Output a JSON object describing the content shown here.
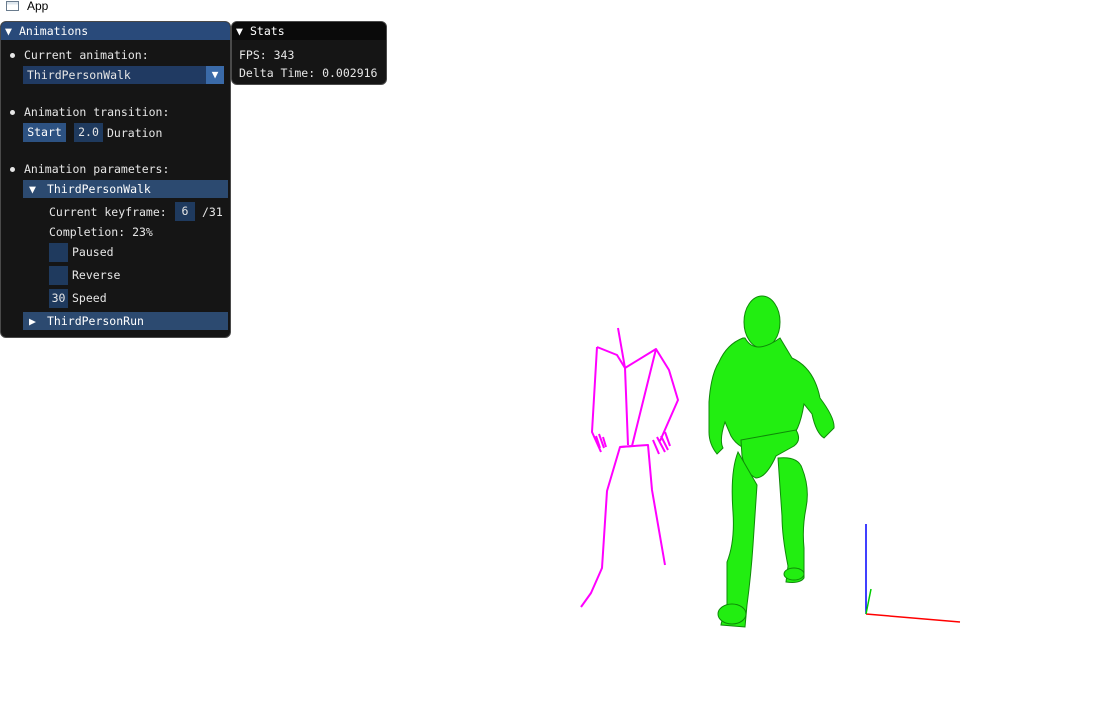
{
  "app": {
    "title": "App"
  },
  "animations_panel": {
    "title": "Animations",
    "current_animation_label": "Current animation:",
    "current_animation_value": "ThirdPersonWalk",
    "transition_label": "Animation transition:",
    "start_button": "Start",
    "duration_value": "2.0",
    "duration_label": "Duration",
    "parameters_label": "Animation parameters:",
    "walk_section": {
      "title": "ThirdPersonWalk",
      "current_keyframe_label": "Current keyframe:",
      "current_keyframe_value": "6",
      "keyframe_total": "/31",
      "completion": "Completion: 23%",
      "paused_label": "Paused",
      "paused": false,
      "reverse_label": "Reverse",
      "reverse": false,
      "speed_value": "30",
      "speed_label": "Speed"
    },
    "run_section": {
      "title": "ThirdPersonRun"
    }
  },
  "stats_panel": {
    "title": "Stats",
    "fps": "FPS: 343",
    "delta_time": "Delta Time: 0.002916"
  },
  "colors": {
    "skeleton": "#ff00ff",
    "model": "#00ff00",
    "axis_x": "#ff0000",
    "axis_y": "#0000ff",
    "axis_z": "#00cc00"
  }
}
